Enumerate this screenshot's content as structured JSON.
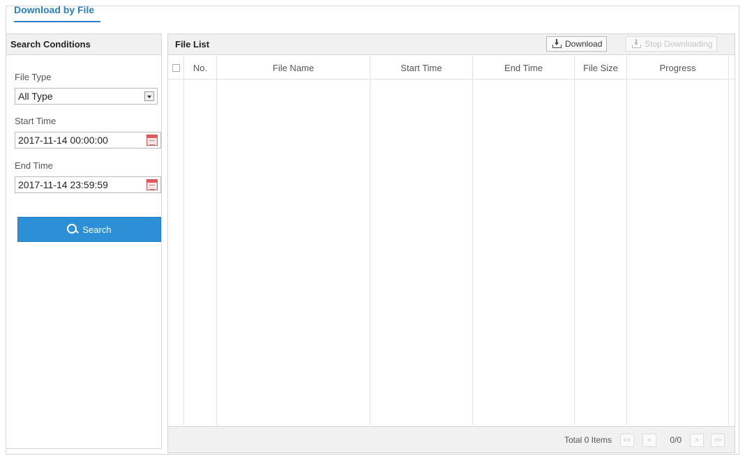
{
  "tab": {
    "label": "Download by File"
  },
  "search_panel": {
    "title": "Search Conditions",
    "file_type_label": "File Type",
    "file_type_value": "All Type",
    "start_time_label": "Start Time",
    "start_time_value": "2017-11-14 00:00:00",
    "end_time_label": "End Time",
    "end_time_value": "2017-11-14 23:59:59",
    "search_button": "Search"
  },
  "file_list": {
    "title": "File List",
    "download_button": "Download",
    "stop_button": "Stop Downloading",
    "columns": [
      "No.",
      "File Name",
      "Start Time",
      "End Time",
      "File Size",
      "Progress"
    ],
    "rows": []
  },
  "pagination": {
    "total": "Total 0 Items",
    "first": "<<",
    "prev": "<",
    "page": "0/0",
    "next": ">",
    "last": ">>"
  },
  "colors": {
    "accent": "#2a7fc4",
    "button": "#2d8fd6"
  }
}
